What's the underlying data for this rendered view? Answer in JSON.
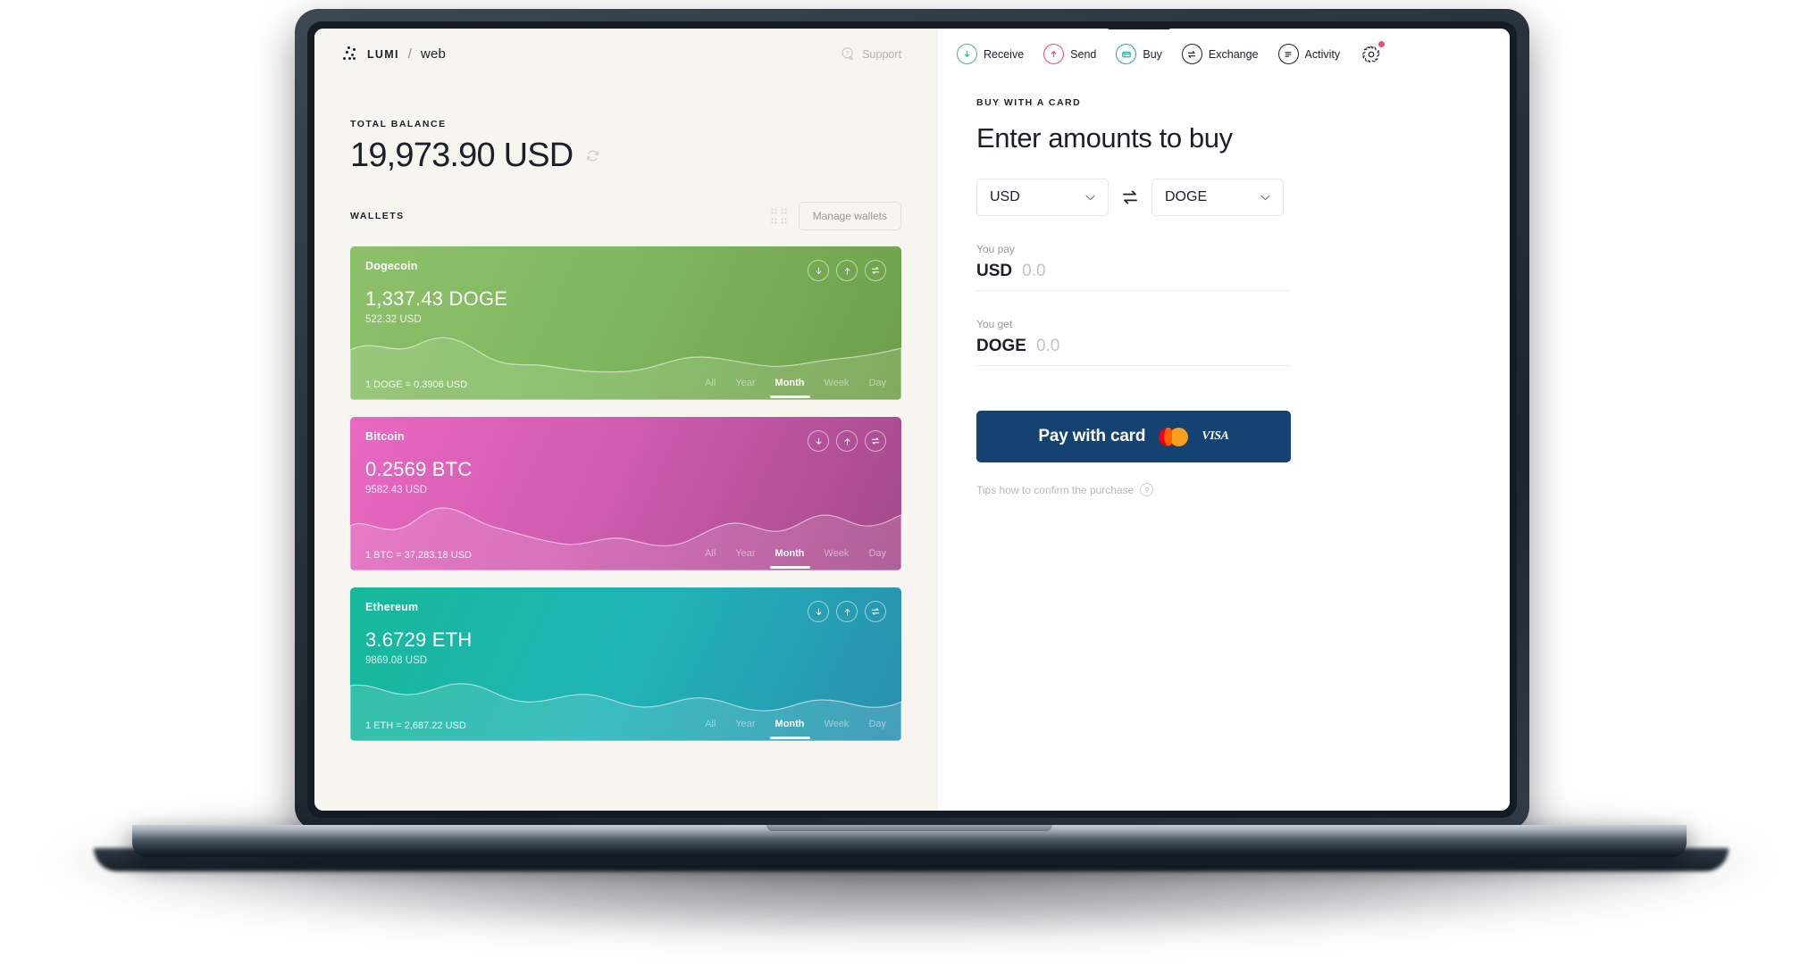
{
  "brand": {
    "name": "LUMI",
    "separator": "/",
    "sub": "web"
  },
  "support": {
    "label": "Support",
    "icon": "question-chat-icon"
  },
  "left": {
    "total_balance_label": "TOTAL BALANCE",
    "total_balance": "19,973.90 USD",
    "refresh_icon": "refresh-icon",
    "wallets_label": "WALLETS",
    "grid_icon": "grid-view-icon",
    "manage_button": "Manage wallets",
    "ranges": [
      "All",
      "Year",
      "Month",
      "Week",
      "Day"
    ],
    "active_range": "Month",
    "wallets": [
      {
        "name": "Dogecoin",
        "amount": "1,337.43 DOGE",
        "usd": "522.32 USD",
        "rate": "1 DOGE = 0.3906 USD",
        "color": "#7fb85f",
        "actions": [
          "receive-icon",
          "send-icon",
          "exchange-icon"
        ]
      },
      {
        "name": "Bitcoin",
        "amount": "0.2569 BTC",
        "usd": "9582.43 USD",
        "rate": "1 BTC = 37,283.18 USD",
        "color": "#d05cb0",
        "actions": [
          "receive-icon",
          "send-icon",
          "exchange-icon"
        ]
      },
      {
        "name": "Ethereum",
        "amount": "3.6729 ETH",
        "usd": "9869.08 USD",
        "rate": "1 ETH = 2,687.22 USD",
        "color": "#20b4b6",
        "actions": [
          "receive-icon",
          "send-icon",
          "exchange-icon"
        ]
      }
    ]
  },
  "nav": {
    "items": [
      {
        "label": "Receive",
        "icon": "arrow-down-circle-icon",
        "accent": "#3cb878",
        "active": false
      },
      {
        "label": "Send",
        "icon": "arrow-up-circle-icon",
        "accent": "#f0476d",
        "active": false
      },
      {
        "label": "Buy",
        "icon": "credit-card-circle-icon",
        "accent": "#22a6a6",
        "active": true
      },
      {
        "label": "Exchange",
        "icon": "swap-circle-icon",
        "accent": "#1b2028",
        "active": false
      },
      {
        "label": "Activity",
        "icon": "list-circle-icon",
        "accent": "#1b2028",
        "active": false
      }
    ],
    "settings": {
      "icon": "gear-icon",
      "has_notification": true,
      "notification_color": "#f0476d"
    }
  },
  "right": {
    "section_label": "BUY WITH A CARD",
    "heading": "Enter amounts to buy",
    "from_currency": "USD",
    "to_currency": "DOGE",
    "swap_icon": "swap-horizontal-icon",
    "chevron_icon": "chevron-down-icon",
    "pay": {
      "label": "You pay",
      "currency": "USD",
      "value": "0.0"
    },
    "get": {
      "label": "You get",
      "currency": "DOGE",
      "value": "0.0"
    },
    "pay_button": {
      "label": "Pay with card",
      "accent": "#144272",
      "cards": [
        "mastercard-logo",
        "VISA"
      ]
    },
    "visa_text": "VISA",
    "tips": {
      "label": "Tips how to confirm the purchase",
      "icon": "question-circle-icon"
    }
  }
}
